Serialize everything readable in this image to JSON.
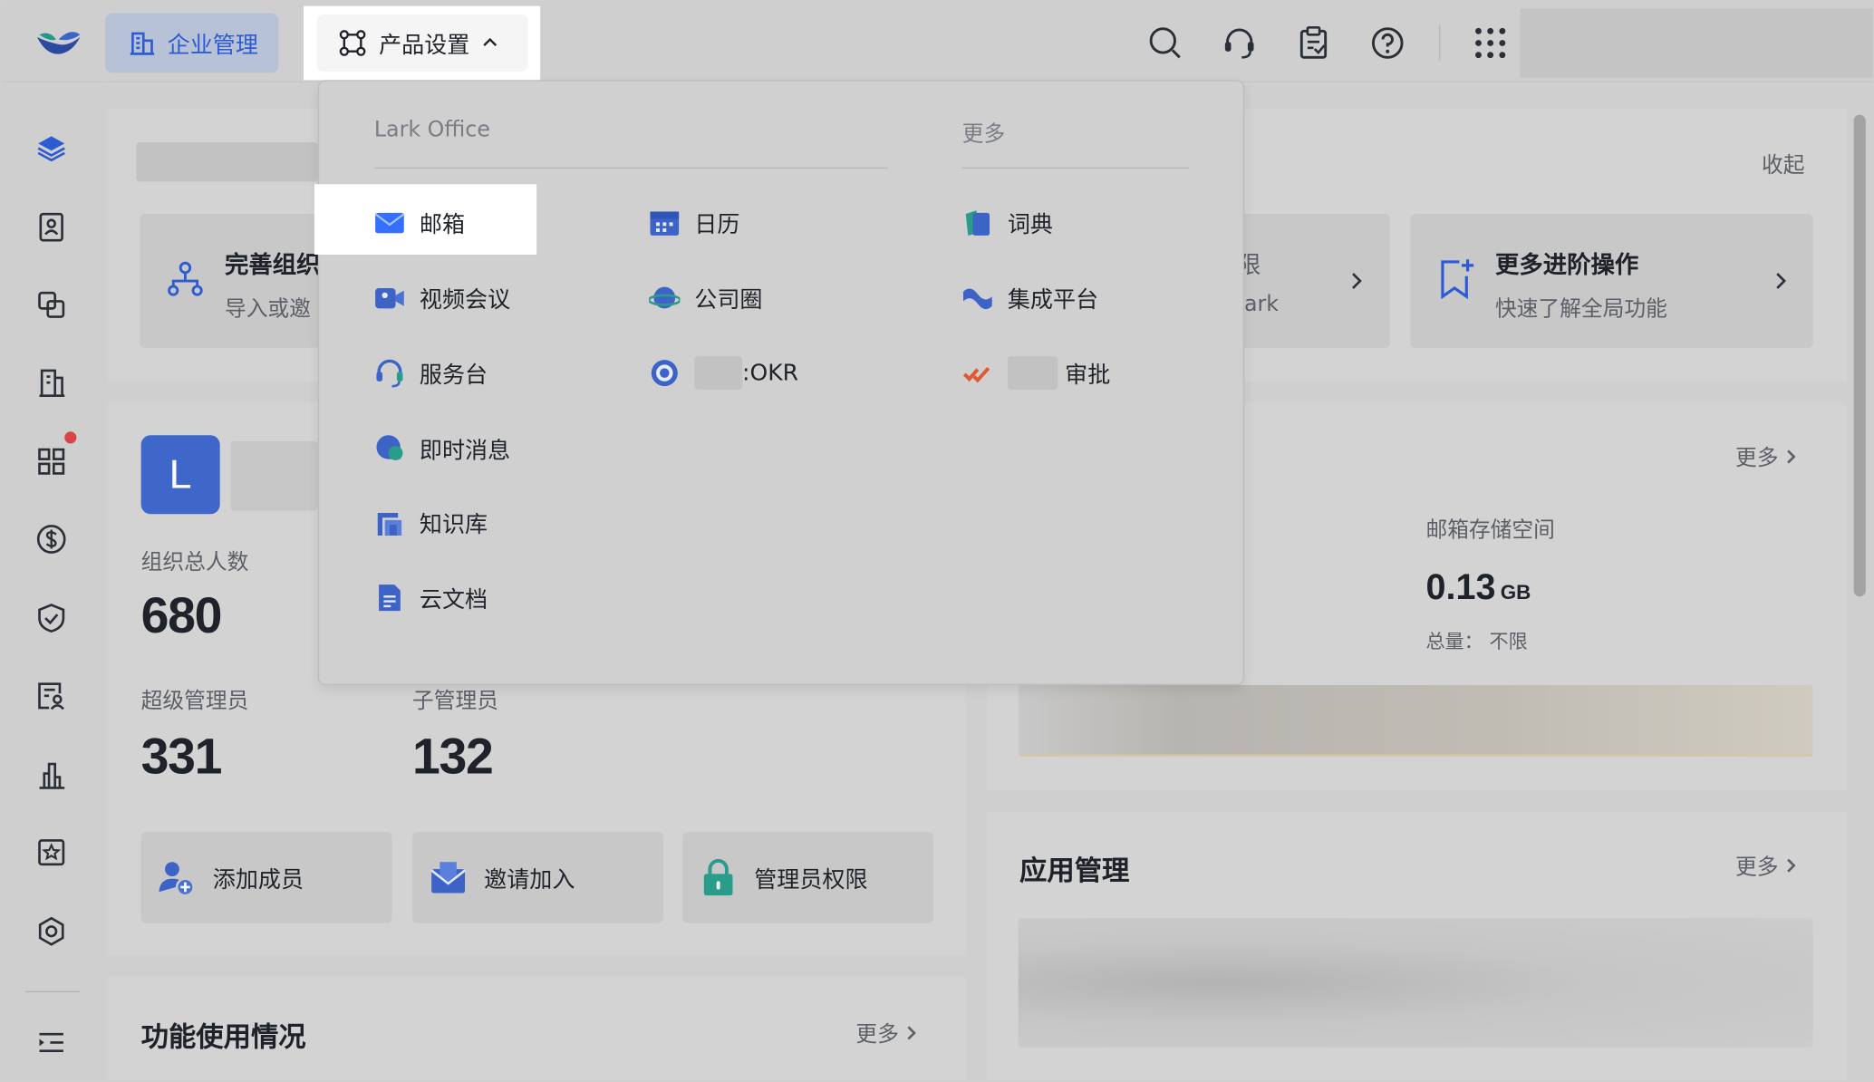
{
  "topbar": {
    "org_button": "企业管理",
    "product_button": "产品设置",
    "icons": [
      "search-icon",
      "headset-icon",
      "clipboard-icon",
      "help-icon",
      "apps-grid-icon"
    ]
  },
  "sidebar": {
    "icons": [
      "layers-icon",
      "contacts-icon",
      "copy-icon",
      "building-icon",
      "grid-icon",
      "dollar-icon",
      "shield-icon",
      "report-icon",
      "chart-icon",
      "star-icon",
      "settings-icon",
      "expand-icon"
    ]
  },
  "guide": {
    "collapse": "收起",
    "card1_title": "完善组织",
    "card1_sub": "导入或邀",
    "card2_title": "限",
    "card2_sub": "ark",
    "card3_title": "更多进阶操作",
    "card3_sub": "快速了解全局功能"
  },
  "org": {
    "avatar_letter": "L",
    "total_label": "组织总人数",
    "total_value": "680",
    "super_admin_label": "超级管理员",
    "super_admin_value": "331",
    "sub_admin_label": "子管理员",
    "sub_admin_value": "132",
    "actions": [
      "添加成员",
      "邀请加入",
      "管理员权限"
    ]
  },
  "storage": {
    "more": "更多",
    "mail_label": "邮箱存储空间",
    "mail_value": "0.13",
    "mail_unit": "GB",
    "mail_total": "总量： 不限"
  },
  "apps": {
    "title": "应用管理",
    "more": "更多"
  },
  "usage": {
    "title": "功能使用情况",
    "more": "更多"
  },
  "dropdown": {
    "col1_header": "Lark Office",
    "col2_header": "更多",
    "col1": [
      "邮箱",
      "视频会议",
      "服务台",
      "即时消息",
      "知识库",
      "云文档"
    ],
    "col2": [
      "日历",
      "公司圈",
      ":OKR"
    ],
    "col3": [
      "词典",
      "集成平台",
      "审批"
    ]
  },
  "colors": {
    "accent_blue": "#2d5bd3",
    "highlight": "#ffffff",
    "badge_red": "#d64646"
  }
}
